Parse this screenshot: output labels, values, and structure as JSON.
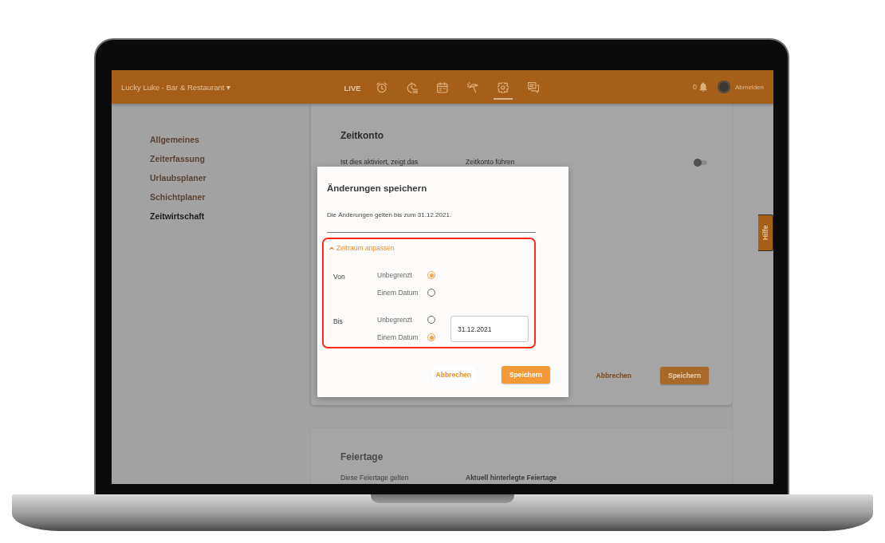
{
  "header": {
    "brand": "Lucky Luke - Bar & Restaurant ▾",
    "nav": [
      {
        "kind": "text",
        "label": "LIVE",
        "selected": false
      },
      {
        "kind": "icon",
        "selected": false
      },
      {
        "kind": "icon",
        "selected": false
      },
      {
        "kind": "icon",
        "selected": false
      },
      {
        "kind": "icon",
        "selected": false
      },
      {
        "kind": "icon",
        "selected": true
      },
      {
        "kind": "icon",
        "selected": false
      }
    ],
    "notifications": {
      "count": "0"
    },
    "logout": "Abmelden"
  },
  "sidebar": {
    "items": [
      {
        "label": "Allgemeines",
        "selected": false
      },
      {
        "label": "Zeiterfassung",
        "selected": false
      },
      {
        "label": "Urlaubsplaner",
        "selected": false
      },
      {
        "label": "Schichtplaner",
        "selected": false
      },
      {
        "label": "Zeitwirtschaft",
        "selected": true
      }
    ]
  },
  "card": {
    "title": "Zeitkonto",
    "description": "Ist dies aktiviert, zeigt das",
    "setting_label": "Zeitkonto führen",
    "toggle": {
      "on": false
    },
    "buttons": [
      {
        "kind": "secondary",
        "label": "Abbrechen"
      },
      {
        "kind": "primary",
        "label": "Speichern"
      }
    ]
  },
  "card_2": {
    "title": "Feiertage",
    "description": "Diese Feiertage gelten",
    "setting_label": "Aktuell hinterlegte Feiertage"
  },
  "help_tab": {
    "label": "Hilfe"
  },
  "dialog": {
    "title": "Änderungen speichern",
    "message": "Die Änderungen gelten bis zum 31.12.2021.",
    "period": {
      "label": "Zeitraum anpassen",
      "expanded": true,
      "groups": [
        {
          "label": "Von",
          "options": [
            {
              "label": "Unbegrenzt",
              "selected": true
            },
            {
              "label": "Einem Datum",
              "selected": false
            }
          ]
        },
        {
          "label": "Bis",
          "options": [
            {
              "label": "Unbegrenzt",
              "selected": false
            },
            {
              "label": "Einem Datum",
              "selected": true
            }
          ],
          "date_field": {
            "value": "31.12.2021"
          }
        }
      ]
    },
    "buttons": [
      {
        "kind": "secondary",
        "label": "Abbrechen"
      },
      {
        "kind": "primary",
        "label": "Speichern"
      }
    ]
  }
}
